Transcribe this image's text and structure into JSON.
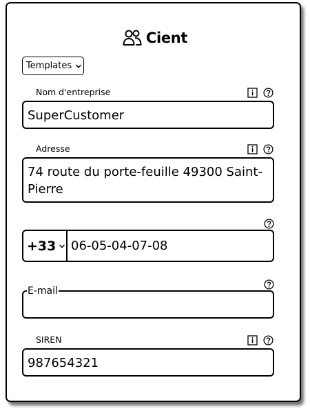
{
  "header": {
    "title": "Cient",
    "icon": "users-icon"
  },
  "templates": {
    "label": "Templates",
    "icon": "chevron-down-icon"
  },
  "company": {
    "label": "Nom d'entreprise",
    "value": "SuperCustomer",
    "icons": [
      "info-icon",
      "help-icon"
    ]
  },
  "address": {
    "label": "Adresse",
    "value": "74 route du porte-feuille 49300 Saint-\nPierre",
    "icons": [
      "info-icon",
      "help-icon"
    ]
  },
  "phone": {
    "country_code": "+33",
    "value": "06-05-04-07-08",
    "icons": [
      "help-icon"
    ]
  },
  "email": {
    "label": "E-mail",
    "value": "",
    "icons": [
      "help-icon"
    ]
  },
  "siren": {
    "label": "SIREN",
    "value": "987654321",
    "icons": [
      "info-icon",
      "help-icon"
    ]
  }
}
